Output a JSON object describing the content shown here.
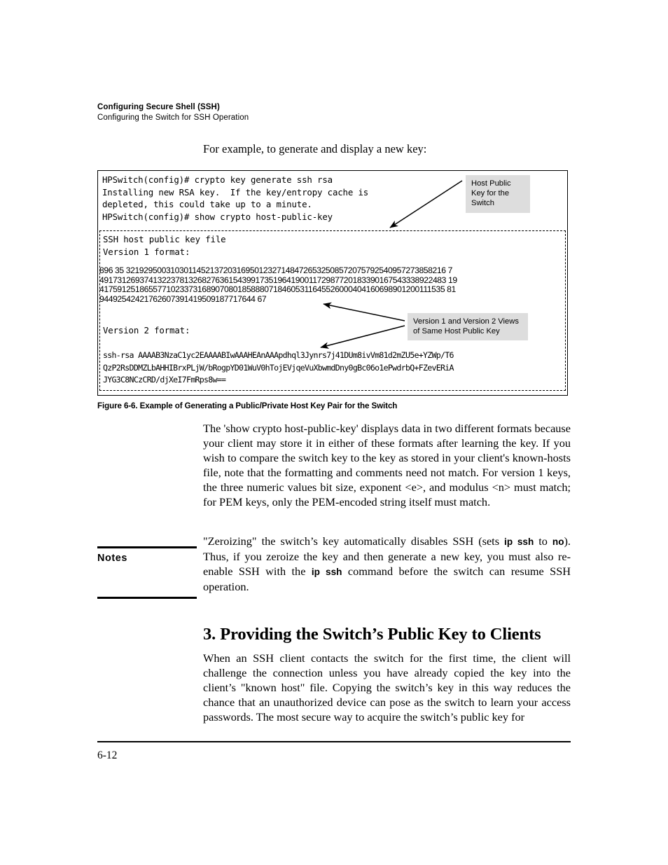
{
  "running_head": {
    "title": "Configuring Secure Shell (SSH)",
    "subtitle": "Configuring the Switch for SSH Operation"
  },
  "intro_line": "For example, to generate and display a new key:",
  "figure": {
    "terminal_lines": "HPSwitch(config)# crypto key generate ssh rsa\nInstalling new RSA key.  If the key/entropy cache is\ndepleted, this could take up to a minute.\nHPSwitch(config)# show crypto host-public-key",
    "keyfile_header": "SSH host public key file\nVersion 1 format:",
    "version1_key": "896 35 32192950031030114521372031695012327148472653250857207579254095727385821674917312693741322378132682763615439917351964190011729877201833901675433389224831941759125186557710233731689070801858880718460531164552600040416069890120011153581944925424217626073914195091877176446 7",
    "version1_lines": [
      "896 35 321929500310301145213720316950123271484726532508572075792540957273858216 7",
      "491731269374132237813268276361543991735196419001172987720183390167543338922483 19",
      "417591251865577102337316890708018588807184605311645526000404160698901200111535 81",
      "94492542421762607391419509187717644 67"
    ],
    "version2_label": "Version 2 format:",
    "version2_lines": [
      "ssh-rsa AAAAB3NzaC1yc2EAAAABIwAAAHEAnAAApdhql3Jynrs7j41DUm8ivVm81d2mZU5e+YZWp/T6",
      "QzP2RsDDMZLbAHHIBrxPLjW/bRogpYD01WuV0hTojEVjqeVuXbwmdDny0gBc06o1ePwdrbQ+FZevERiA",
      "JYG3C8NCzCRD/djXeI7FmRps8w=="
    ],
    "callout_host": "Host Public Key for the Switch",
    "callout_views": "Version 1 and Version 2 Views of Same Host Public Key",
    "caption": "Figure 6-6. Example of Generating a Public/Private Host Key Pair for the Switch"
  },
  "paragraphs": {
    "formats": "The 'show crypto host-public-key' displays data in two different formats because your client may store it in either of these formats after learning the key.  If you wish to compare the switch key to the key as stored in your client's known-hosts file, note that the formatting and comments need not match.  For version 1 keys, the three numeric values bit size, exponent <e>, and modulus <n> must match; for PEM keys, only the PEM-encoded string itself must match.",
    "clients": "When an SSH client contacts the switch for the first time, the client will challenge the connection unless you have already copied the key into the client’s \"known host\" file. Copying the switch’s key in this way reduces the chance that an unauthorized device can pose as the switch to learn your access passwords. The most secure way to acquire the switch’s public key for"
  },
  "note": {
    "label": "Notes",
    "text_1": "\"Zeroizing\" the switch’s key automatically disables SSH (sets ",
    "bold_1": "ip ssh",
    "text_2": " to ",
    "bold_2": "no",
    "text_3": "). Thus, if you zeroize the key and then generate a new key, you must also re-enable SSH with the ",
    "bold_3": "ip ssh",
    "text_4": " command before the switch can resume SSH operation."
  },
  "section_heading": "3. Providing the Switch’s Public Key to Clients",
  "footer": {
    "page_number": "6-12"
  },
  "colors": {
    "callout_background": "#dddddd",
    "text": "#000000",
    "page_background": "#ffffff"
  }
}
